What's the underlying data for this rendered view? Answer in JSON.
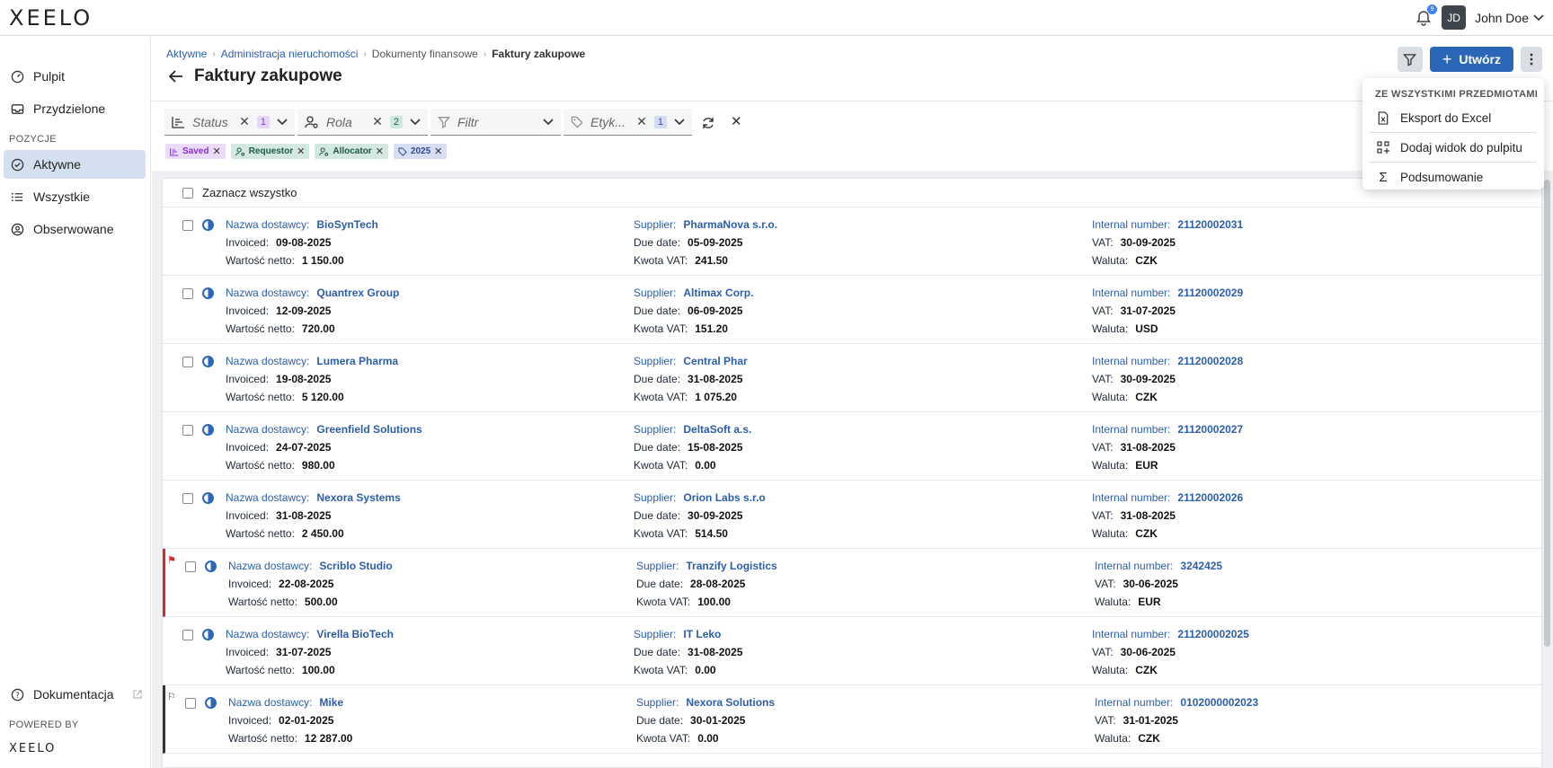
{
  "app": {
    "logo": "XEELO",
    "powered_logo": "XEELO"
  },
  "topbar": {
    "notifications": "9",
    "avatar_initials": "JD",
    "user_name": "John Doe"
  },
  "sidebar": {
    "items": [
      {
        "label": "Pulpit"
      },
      {
        "label": "Przydzielone"
      },
      {
        "label": "Aktywne"
      },
      {
        "label": "Wszystkie"
      },
      {
        "label": "Obserwowane"
      },
      {
        "label": "Dokumentacja"
      }
    ],
    "section_positions": "POZYCJE",
    "powered_by": "POWERED BY"
  },
  "breadcrumb": [
    "Aktywne",
    "Administracja nieruchomości",
    "Dokumenty finansowe",
    "Faktury zakupowe"
  ],
  "page": {
    "title": "Faktury zakupowe",
    "create_label": "Utwórz"
  },
  "filters": {
    "status": {
      "label": "Status",
      "count": "1"
    },
    "rola": {
      "label": "Rola",
      "count": "2"
    },
    "filtr": {
      "label": "Filtr"
    },
    "etyk": {
      "label": "Etyk...",
      "count": "1"
    },
    "chips": [
      "Saved",
      "Requestor",
      "Allocator",
      "2025"
    ]
  },
  "menu": {
    "title": "ZE WSZYSTKIMI PRZEDMIOTAMI",
    "items": [
      "Eksport do Excel",
      "Dodaj widok do pulpitu",
      "Podsumowanie"
    ]
  },
  "list": {
    "select_all": "Zaznacz wszystko",
    "labels": {
      "vendor": "Nazwa dostawcy:",
      "invoiced": "Invoiced:",
      "net": "Wartość netto:",
      "supplier": "Supplier:",
      "due": "Due date:",
      "vat_amount": "Kwota VAT:",
      "internal": "Internal number:",
      "vat": "VAT:",
      "currency": "Waluta:"
    },
    "rows": [
      {
        "vendor": "BioSynTech",
        "invoiced": "09-08-2025",
        "net": "1 150.00",
        "supplier": "PharmaNova s.r.o.",
        "due": "05-09-2025",
        "vat_amount": "241.50",
        "internal": "21120002031",
        "vat": "30-09-2025",
        "currency": "CZK"
      },
      {
        "vendor": "Quantrex Group",
        "invoiced": "12-09-2025",
        "net": "720.00",
        "supplier": "Altimax Corp.",
        "due": "06-09-2025",
        "vat_amount": "151.20",
        "internal": "21120002029",
        "vat": "31-07-2025",
        "currency": "USD"
      },
      {
        "vendor": "Lumera Pharma",
        "invoiced": "19-08-2025",
        "net": "5 120.00",
        "supplier": "Central Phar",
        "due": "31-08-2025",
        "vat_amount": "1 075.20",
        "internal": "21120002028",
        "vat": "30-09-2025",
        "currency": "CZK"
      },
      {
        "vendor": "Greenfield Solutions",
        "invoiced": "24-07-2025",
        "net": "980.00",
        "supplier": "DeltaSoft a.s.",
        "due": "15-08-2025",
        "vat_amount": "0.00",
        "internal": "21120002027",
        "vat": "31-08-2025",
        "currency": "EUR"
      },
      {
        "vendor": "Nexora Systems",
        "invoiced": "31-08-2025",
        "net": "2 450.00",
        "supplier": "Orion Labs s.r.o",
        "due": "30-09-2025",
        "vat_amount": "514.50",
        "internal": "21120002026",
        "vat": "31-08-2025",
        "currency": "CZK"
      },
      {
        "vendor": "Scriblo Studio",
        "invoiced": "22-08-2025",
        "net": "500.00",
        "supplier": "Tranzify Logistics",
        "due": "28-08-2025",
        "vat_amount": "100.00",
        "internal": "3242425",
        "vat": "30-06-2025",
        "currency": "EUR"
      },
      {
        "vendor": "Virella BioTech",
        "invoiced": "31-07-2025",
        "net": "100.00",
        "supplier": "IT Leko",
        "due": "31-08-2025",
        "vat_amount": "0.00",
        "internal": "211200002025",
        "vat": "30-06-2025",
        "currency": "CZK"
      },
      {
        "vendor": "Mike",
        "invoiced": "02-01-2025",
        "net": "12 287.00",
        "supplier": "Nexora Solutions",
        "due": "30-01-2025",
        "vat_amount": "0.00",
        "internal": "0102000002023",
        "vat": "31-01-2025",
        "currency": "CZK"
      }
    ]
  }
}
